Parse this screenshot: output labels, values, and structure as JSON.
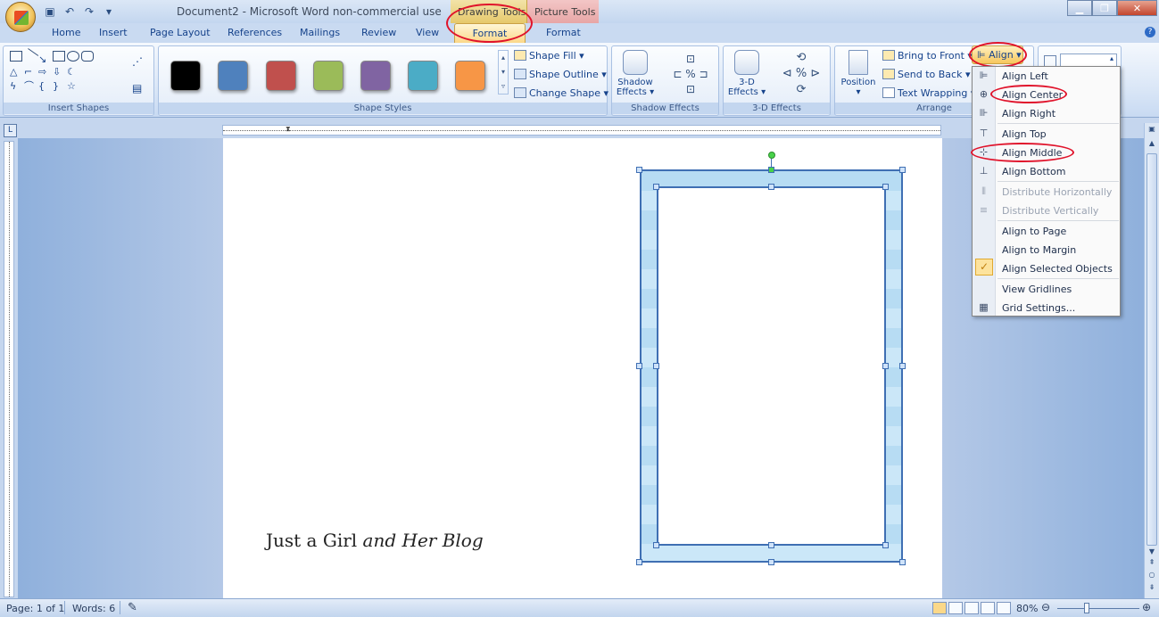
{
  "window": {
    "title": "Document2 - Microsoft Word non-commercial use",
    "context_tabs": [
      "Drawing Tools",
      "Picture Tools"
    ],
    "controls": [
      "minimize",
      "maximize",
      "close"
    ]
  },
  "tabs": [
    "Home",
    "Insert",
    "Page Layout",
    "References",
    "Mailings",
    "Review",
    "View",
    "Format",
    "Format"
  ],
  "ribbon": {
    "groups": {
      "insert_shapes": "Insert Shapes",
      "shape_styles": "Shape Styles",
      "shadow_effects": "Shadow Effects",
      "3d_effects": "3-D Effects",
      "arrange": "Arrange"
    },
    "shape_style_colors": [
      "#000000",
      "#4f81bd",
      "#c0504d",
      "#9bbb59",
      "#8064a2",
      "#4bacc6",
      "#f79646"
    ],
    "shape_fill": "Shape Fill",
    "shape_outline": "Shape Outline",
    "change_shape": "Change Shape",
    "shadow_effects_btn": "Shadow Effects",
    "threed_effects_btn": "3-D Effects",
    "position": "Position",
    "bring_to_front": "Bring to Front",
    "send_to_back": "Send to Back",
    "text_wrapping": "Text Wrapping",
    "align": "Align"
  },
  "align_menu": [
    {
      "label": "Align Left",
      "icon": "align-left-icon",
      "disabled": false
    },
    {
      "label": "Align Center",
      "icon": "align-center-icon",
      "disabled": false
    },
    {
      "label": "Align Right",
      "icon": "align-right-icon",
      "disabled": false
    },
    {
      "label": "Align Top",
      "icon": "align-top-icon",
      "disabled": false
    },
    {
      "label": "Align Middle",
      "icon": "align-middle-icon",
      "disabled": false
    },
    {
      "label": "Align Bottom",
      "icon": "align-bottom-icon",
      "disabled": false
    },
    {
      "label": "Distribute Horizontally",
      "icon": "distribute-horizontally-icon",
      "disabled": true
    },
    {
      "label": "Distribute Vertically",
      "icon": "distribute-vertically-icon",
      "disabled": true
    },
    {
      "label": "Align to Page",
      "icon": "",
      "disabled": false
    },
    {
      "label": "Align to Margin",
      "icon": "",
      "disabled": false
    },
    {
      "label": "Align Selected Objects",
      "icon": "checkmark-icon",
      "disabled": false
    },
    {
      "label": "View Gridlines",
      "icon": "",
      "disabled": false
    },
    {
      "label": "Grid Settings...",
      "icon": "grid-icon",
      "disabled": false
    }
  ],
  "document": {
    "blog_text_regular": "Just a Girl",
    "blog_text_script": "and Her Blog"
  },
  "status": {
    "page": "Page: 1 of 1",
    "words": "Words: 6",
    "zoom": "80%"
  },
  "colors": {
    "highlight_circle": "#e0132b",
    "frame_stroke": "#3f6fb3",
    "frame_fill": "#b7dcf3"
  }
}
